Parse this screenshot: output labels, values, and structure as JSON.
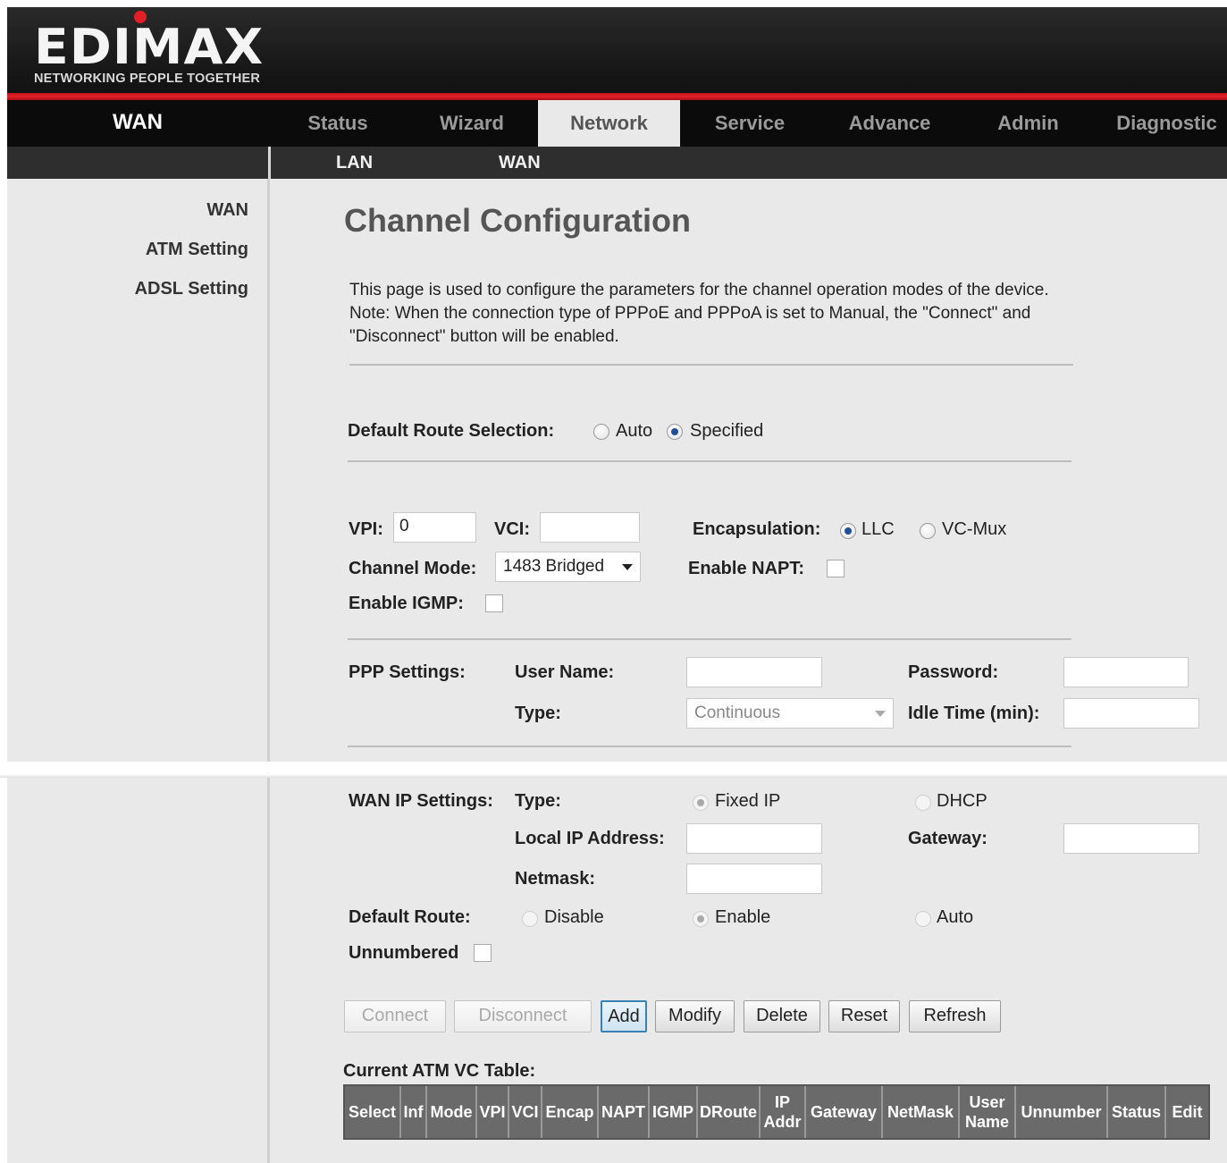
{
  "brand": {
    "name": "EDIMAX",
    "tagline": "NETWORKING PEOPLE TOGETHER",
    "accent_color": "#e21e26"
  },
  "nav": {
    "section_title": "WAN",
    "tabs": [
      "Status",
      "Wizard",
      "Network",
      "Service",
      "Advance",
      "Admin",
      "Diagnostic"
    ],
    "active_tab": "Network"
  },
  "subnav": {
    "items": [
      "LAN",
      "WAN"
    ]
  },
  "sidebar": {
    "items": [
      "WAN",
      "ATM Setting",
      "ADSL Setting"
    ]
  },
  "page": {
    "title": "Channel Configuration",
    "description_lines": [
      "This page is used to configure the parameters for the channel operation modes of the device.",
      "Note: When the connection type of PPPoE and PPPoA is set to Manual, the \"Connect\" and",
      "\"Disconnect\" button will be enabled."
    ]
  },
  "default_route_selection": {
    "label": "Default Route Selection:",
    "options": [
      "Auto",
      "Specified"
    ],
    "selected": "Specified"
  },
  "vc": {
    "vpi_label": "VPI:",
    "vpi_value": "0",
    "vci_label": "VCI:",
    "vci_value": "",
    "encapsulation_label": "Encapsulation:",
    "encapsulation_options": [
      "LLC",
      "VC-Mux"
    ],
    "encapsulation_selected": "LLC",
    "channel_mode_label": "Channel Mode:",
    "channel_mode_value": "1483 Bridged",
    "enable_napt_label": "Enable NAPT:",
    "enable_napt": false,
    "enable_igmp_label": "Enable IGMP:",
    "enable_igmp": false
  },
  "ppp": {
    "section_label": "PPP Settings:",
    "user_name_label": "User Name:",
    "user_name": "",
    "password_label": "Password:",
    "password": "",
    "type_label": "Type:",
    "type_value": "Continuous",
    "idle_time_label": "Idle Time (min):",
    "idle_time": ""
  },
  "wan_ip": {
    "section_label": "WAN IP Settings:",
    "type_label": "Type:",
    "type_options": [
      "Fixed IP",
      "DHCP"
    ],
    "type_selected": "Fixed IP",
    "local_ip_label": "Local IP Address:",
    "local_ip": "",
    "gateway_label": "Gateway:",
    "gateway": "",
    "netmask_label": "Netmask:",
    "netmask": ""
  },
  "default_route": {
    "label": "Default Route:",
    "options": [
      "Disable",
      "Enable",
      "Auto"
    ],
    "selected": "Enable"
  },
  "unnumbered": {
    "label": "Unnumbered",
    "checked": false
  },
  "buttons": {
    "connect": "Connect",
    "disconnect": "Disconnect",
    "add": "Add",
    "modify": "Modify",
    "delete": "Delete",
    "reset": "Reset",
    "refresh": "Refresh"
  },
  "vc_table": {
    "title": "Current ATM VC Table:",
    "columns": [
      "Select",
      "Inf",
      "Mode",
      "VPI",
      "VCI",
      "Encap",
      "NAPT",
      "IGMP",
      "DRoute",
      "IP Addr",
      "Gateway",
      "NetMask",
      "User Name",
      "Unnumber",
      "Status",
      "Edit"
    ],
    "rows": []
  }
}
